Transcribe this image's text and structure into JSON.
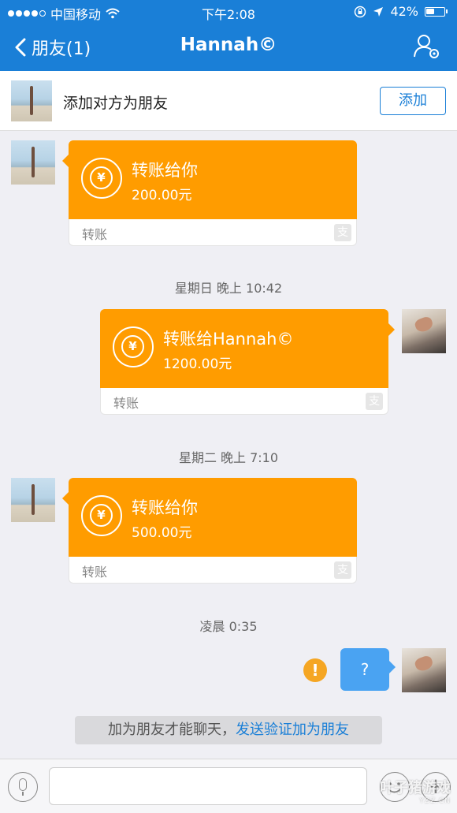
{
  "status_bar": {
    "carrier": "中国移动",
    "time": "下午2:08",
    "battery": "42%",
    "icons": [
      "wifi-icon",
      "lock-rotation-icon",
      "location-arrow-icon",
      "battery-icon"
    ]
  },
  "nav": {
    "back_label": "朋友(1)",
    "title": "Hannah©",
    "settings_icon": "user-settings-icon"
  },
  "add_friend_bar": {
    "label": "添加对方为朋友",
    "button": "添加"
  },
  "messages": [
    {
      "side": "left",
      "type": "transfer",
      "title": "转账给你",
      "amount": "200.00元",
      "footer": "转账"
    },
    {
      "type": "timestamp",
      "text": "星期日 晚上 10:42"
    },
    {
      "side": "right",
      "type": "transfer",
      "title": "转账给Hannah©",
      "amount": "1200.00元",
      "footer": "转账"
    },
    {
      "type": "timestamp",
      "text": "星期二 晚上 7:10"
    },
    {
      "side": "left",
      "type": "transfer",
      "title": "转账给你",
      "amount": "500.00元",
      "footer": "转账"
    },
    {
      "type": "timestamp",
      "text": "凌晨 0:35"
    },
    {
      "side": "right",
      "type": "text",
      "text": "?",
      "status": "failed"
    }
  ],
  "notice": {
    "text": "加为朋友才能聊天，",
    "link": "发送验证加为朋友"
  },
  "input_bar": {
    "placeholder": "",
    "plus": "+"
  },
  "watermark": {
    "line1": "叶子猪游戏",
    "line2": "YZZ.CN"
  },
  "colors": {
    "header": "#1a7fd7",
    "transfer": "#ff9c00",
    "bubble": "#4aa3f2",
    "warning": "#f5a623"
  }
}
